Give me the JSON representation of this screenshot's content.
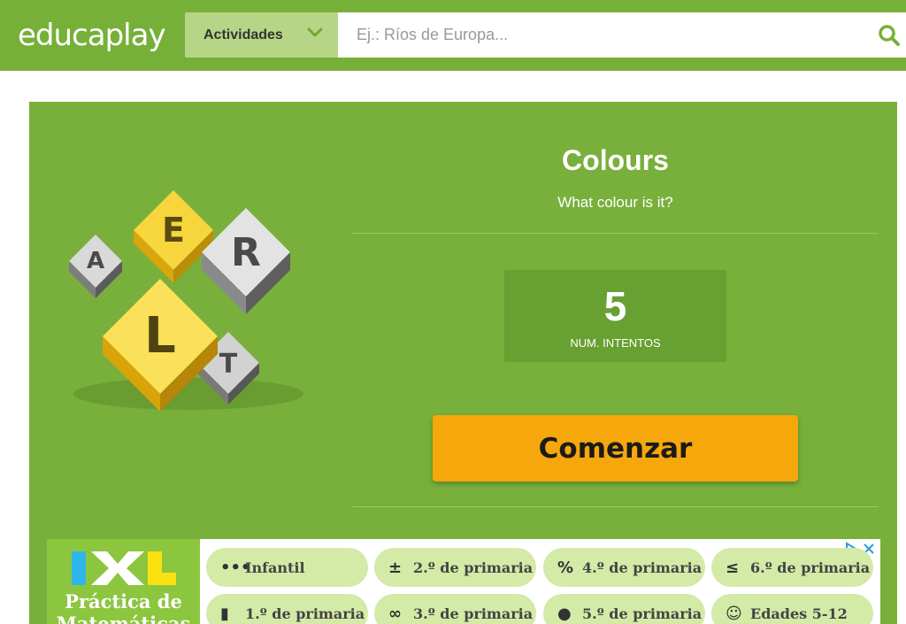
{
  "header": {
    "logo_light": "educa",
    "logo_bold": "play",
    "dropdown_label": "Actividades",
    "search_placeholder": "Ej.: Ríos de Europa..."
  },
  "activity": {
    "title": "Colours",
    "subtitle": "What colour is it?",
    "attempts_value": "5",
    "attempts_label": "NUM. INTENTOS",
    "start_button": "Comenzar"
  },
  "ad": {
    "logo_text": "Práctica de",
    "logo_text_2": "Matemáticas",
    "pills": [
      {
        "icon": "•••",
        "label": "Infantil"
      },
      {
        "icon": "±",
        "label": "2.º de primaria"
      },
      {
        "icon": "%",
        "label": "4.º de primaria"
      },
      {
        "icon": "≤",
        "label": "6.º de primaria"
      },
      {
        "icon": "▮",
        "label": "1.º de primaria"
      },
      {
        "icon": "∞",
        "label": "3.º de primaria"
      },
      {
        "icon": "●",
        "label": "5.º de primaria"
      },
      {
        "icon": "☺",
        "label": "Edades 5-12"
      }
    ]
  },
  "colors": {
    "header_green": "#76b038",
    "card_green": "#78b03b",
    "button_orange": "#f6a70b"
  }
}
